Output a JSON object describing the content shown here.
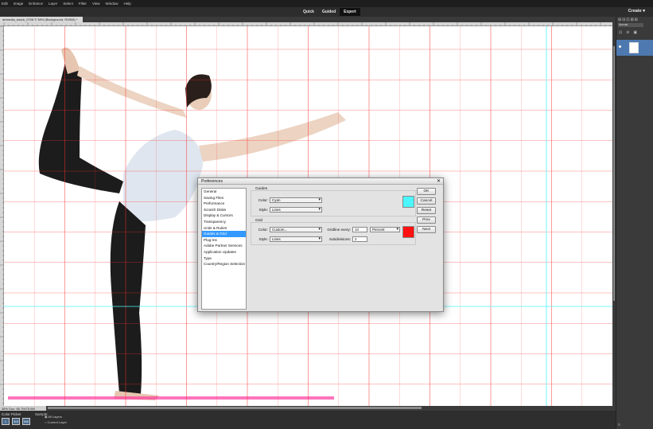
{
  "menubar": {
    "items": [
      "Edit",
      "Image",
      "Enhance",
      "Layer",
      "Select",
      "Filter",
      "View",
      "Window",
      "Help"
    ]
  },
  "modes": {
    "quick": "Quick",
    "guided": "Guided",
    "expert": "Expert",
    "create": "Create ▾"
  },
  "document": {
    "tab_title": "artmedia_istock_0708 © 38% (Background, RGB/8) *"
  },
  "status": {
    "text": "38% Doc: 66.7M/75.6M"
  },
  "tool": {
    "name": "Color Picker",
    "sample_label": "Sample:",
    "option_all": "All Layers",
    "option_current": "Current Layer",
    "sample_buttons": [
      "1",
      "3x3",
      "5x5"
    ]
  },
  "layers": {
    "blend_mode": "Normal"
  },
  "dialog": {
    "title": "Preferences",
    "categories": [
      "General",
      "Saving Files",
      "Performance",
      "Scratch Disks",
      "Display & Cursors",
      "Transparency",
      "Units & Rulers",
      "Guides & Grid",
      "Plug-Ins",
      "Adobe Partner Services",
      "Application Updates",
      "Type",
      "Country/Region Selection"
    ],
    "selected_index": 7,
    "guides": {
      "section": "Guides",
      "color_label": "Color:",
      "color_value": "Cyan",
      "style_label": "Style:",
      "style_value": "Lines",
      "swatch_color": "#4cf6ff"
    },
    "grid": {
      "section": "Grid",
      "color_label": "Color:",
      "color_value": "Custom...",
      "style_label": "Style:",
      "style_value": "Lines",
      "gridline_label": "Gridline every:",
      "gridline_value": "10",
      "unit_value": "Percent",
      "subdiv_label": "Subdivisions:",
      "subdiv_value": "2",
      "swatch_color": "#ff1111"
    },
    "buttons": {
      "ok": "OK",
      "cancel": "Cancel",
      "reset": "Reset",
      "prev": "Prev",
      "next": "Next"
    }
  }
}
